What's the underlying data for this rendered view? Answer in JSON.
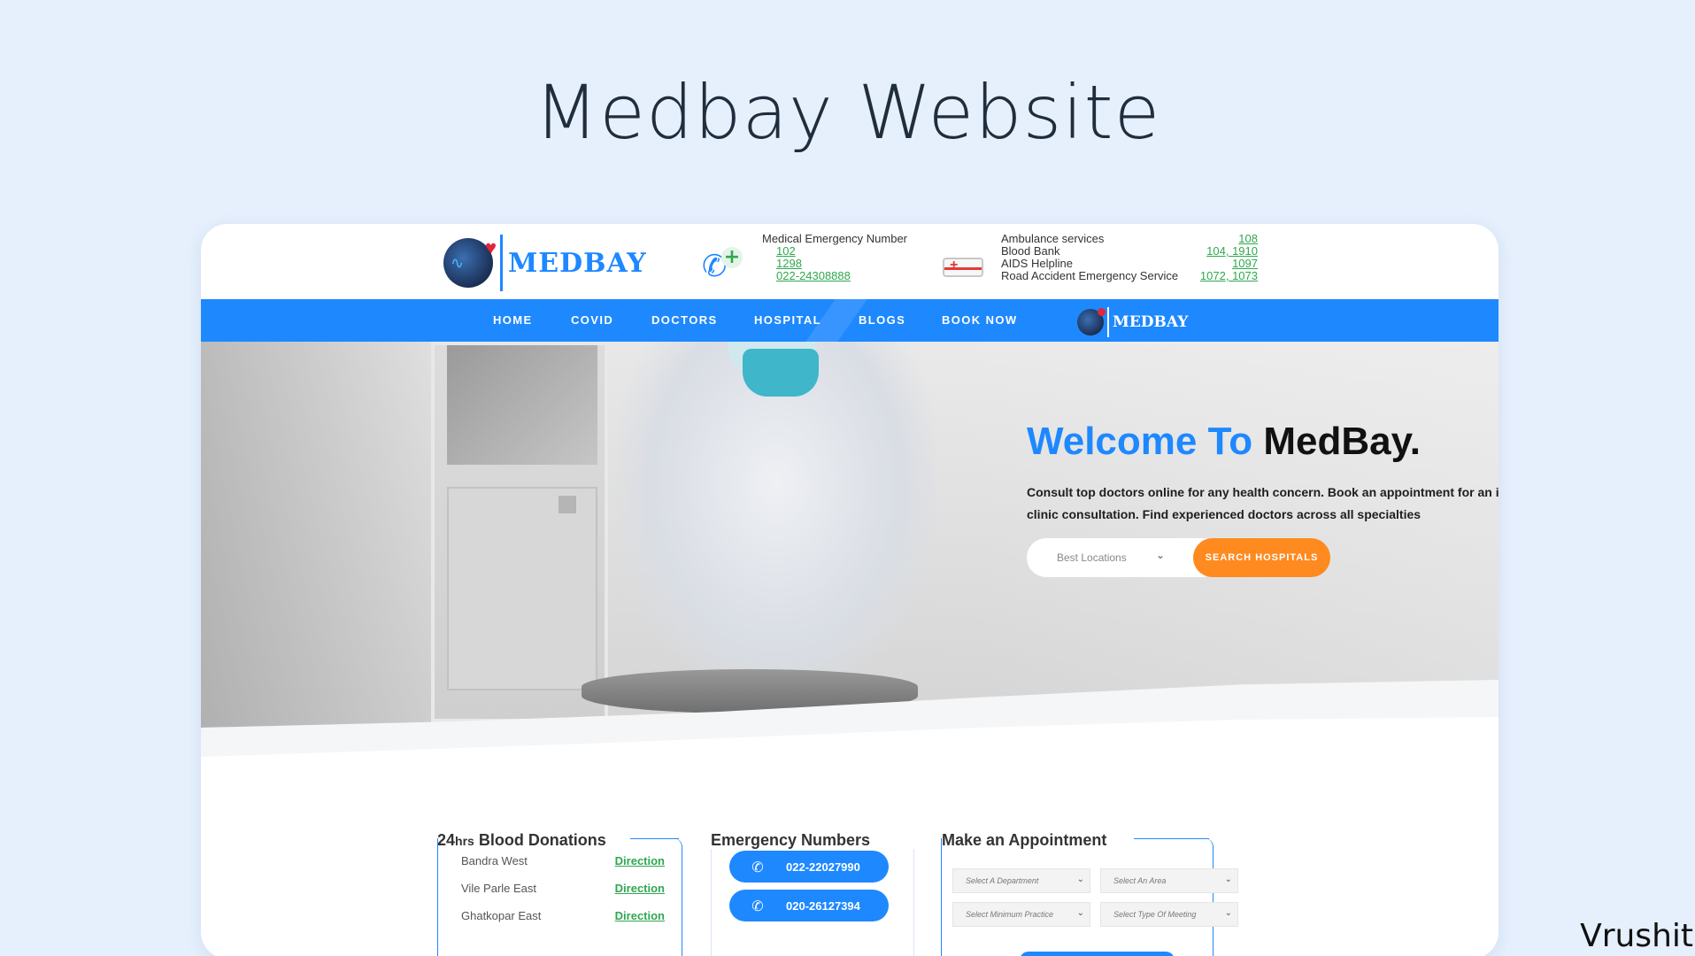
{
  "slide": {
    "title": "Medbay Website",
    "author": "Vrushit"
  },
  "header": {
    "logo_text": "MEDBAY",
    "emergency": {
      "label": "Medical Emergency Number",
      "numbers": [
        "102",
        "1298",
        "022-24308888"
      ]
    },
    "services": [
      {
        "label": "Ambulance services",
        "numbers": "108"
      },
      {
        "label": "Blood Bank",
        "numbers": "104, 1910"
      },
      {
        "label": "AIDS Helpline",
        "numbers": "1097"
      },
      {
        "label": "Road Accident Emergency Service",
        "numbers": "1072, 1073"
      }
    ]
  },
  "nav": {
    "items": [
      "HOME",
      "COVID",
      "DOCTORS",
      "HOSPITAL",
      "BLOGS",
      "BOOK NOW"
    ],
    "logo_text": "MEDBAY"
  },
  "hero": {
    "welcome_blue": "Welcome To",
    "welcome_dark": "MedBay.",
    "description": "Consult top doctors online for any health concern. Book an appointment for an in-clinic consultation. Find experienced doctors across all specialties",
    "location_value": "Best Locations",
    "search_label": "SEARCH HOSPITALS"
  },
  "blood": {
    "title_pre": "24",
    "title_hrs": "hrs",
    "title_post": " Blood Donations",
    "rows": [
      {
        "area": "Bandra West",
        "link": "Direction"
      },
      {
        "area": "Vile Parle East",
        "link": "Direction"
      },
      {
        "area": "Ghatkopar East",
        "link": "Direction"
      }
    ]
  },
  "emergency_card": {
    "title": "Emergency Numbers",
    "numbers": [
      "022-22027990",
      "020-26127394"
    ]
  },
  "appointment": {
    "title": "Make an Appointment",
    "selects": [
      "Select A Department",
      "Select An Area",
      "Select Minimum Practice",
      "Select Type Of Meeting"
    ]
  },
  "icons": {
    "phone": "phone-plus-icon",
    "ambulance": "ambulance-icon",
    "call": "phone-call-icon",
    "chevron": "chevron-down-icon"
  },
  "colors": {
    "brand_blue": "#1e88ff",
    "accent_orange": "#ff8a1f",
    "link_green": "#2fa84f",
    "background": "#e6f0fd"
  }
}
